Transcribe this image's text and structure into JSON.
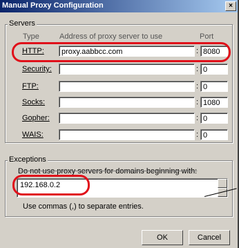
{
  "window": {
    "title": "Manual Proxy Configuration",
    "close_symbol": "×"
  },
  "servers": {
    "group_label": "Servers",
    "col_type": "Type",
    "col_address": "Address of proxy server to use",
    "col_port": "Port",
    "rows": [
      {
        "label": "HTTP:",
        "address": "proxy.aabbcc.com",
        "port": "8080"
      },
      {
        "label": "Security:",
        "address": "",
        "port": "0"
      },
      {
        "label": "FTP:",
        "address": "",
        "port": "0"
      },
      {
        "label": "Socks:",
        "address": "",
        "port": "1080"
      },
      {
        "label": "Gopher:",
        "address": "",
        "port": "0"
      },
      {
        "label": "WAIS:",
        "address": "",
        "port": "0"
      }
    ]
  },
  "exceptions": {
    "group_label": "Exceptions",
    "description": "Do not use proxy servers for domains beginning with:",
    "value": "192.168.0.2",
    "hint": "Use commas (,) to separate entries."
  },
  "buttons": {
    "ok": "OK",
    "cancel": "Cancel"
  },
  "colors": {
    "highlight": "#e0101a",
    "titlebar_start": "#0a246a",
    "titlebar_end": "#a6caf0"
  }
}
